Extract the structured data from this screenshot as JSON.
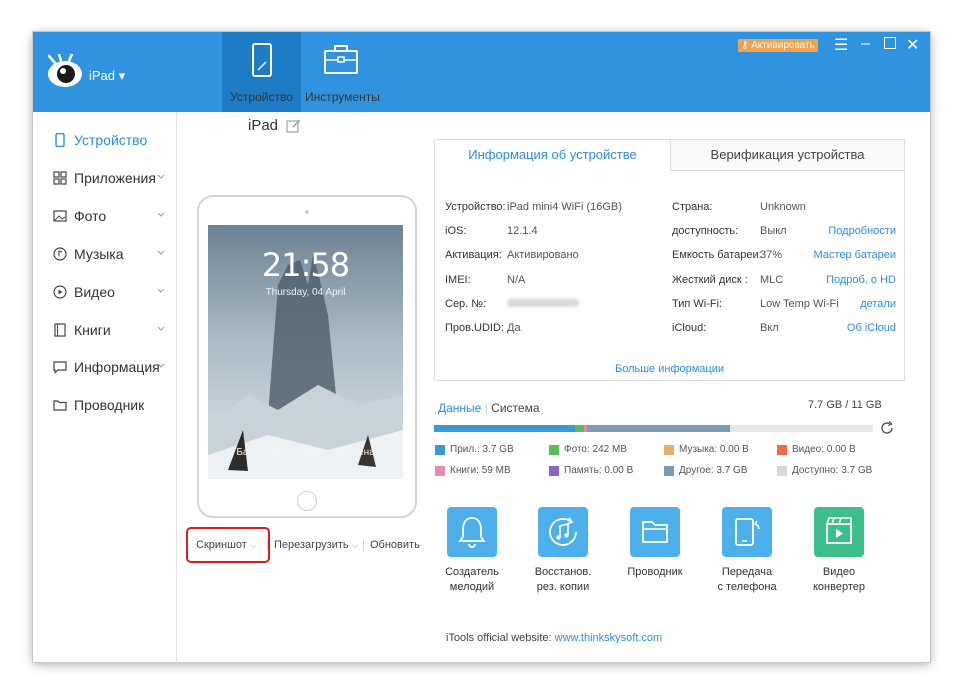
{
  "titlebar": {
    "device_name": "iPad ▾",
    "tabs": [
      "Устройство",
      "Инструменты"
    ],
    "activate_label": "Активировать"
  },
  "sidebar": {
    "items": [
      "Устройство",
      "Приложения",
      "Фото",
      "Музыка",
      "Видео",
      "Книги",
      "Информация",
      "Проводник"
    ]
  },
  "device": {
    "title": "iPad",
    "clock": "21:58",
    "date": "Thursday, 04 April",
    "battery_text": "Батарея полностью заряжена"
  },
  "actions": {
    "screenshot": "Скриншот",
    "reboot": "Перезагрузить",
    "refresh": "Обновить"
  },
  "info": {
    "tabs": [
      "Информация об устройстве",
      "Верификация устройства"
    ],
    "left": [
      {
        "label": "Устройство:",
        "value": "iPad mini4 WiFi   (16GB)"
      },
      {
        "label": "iOS:",
        "value": "12.1.4"
      },
      {
        "label": "Активация:",
        "value": "Активировано"
      },
      {
        "label": "IMEI:",
        "value": "N/A"
      },
      {
        "label": "Сер. №:",
        "value": ""
      },
      {
        "label": "Пров.UDID:",
        "value": "Да"
      }
    ],
    "right": [
      {
        "label": "Страна:",
        "value": "Unknown",
        "link": ""
      },
      {
        "label": "доступность:",
        "value": "Выкл",
        "link": "Подробности"
      },
      {
        "label": "Емкость батареи:",
        "value": "37%",
        "link": "Мастер батареи"
      },
      {
        "label": "Жесткий диск :",
        "value": "MLC",
        "link": "Подроб. о HD"
      },
      {
        "label": "Тип Wi-Fi:",
        "value": "Low Temp Wi-Fi",
        "link": "детали"
      },
      {
        "label": "iCloud:",
        "value": "Вкл",
        "link": "Об iCloud"
      }
    ],
    "more": "Больше информации"
  },
  "storage": {
    "tab_data": "Данные",
    "tab_system": "Система",
    "total": "7.7 GB / 11 GB",
    "used_fraction": 0.7,
    "segments": [
      {
        "name": "Прил.",
        "value": "3.7 GB",
        "color": "#3b9ad8"
      },
      {
        "name": "Фото",
        "value": "242 MB",
        "color": "#5bbd59"
      },
      {
        "name": "Музыка",
        "value": "0.00 B",
        "color": "#e3b36b"
      },
      {
        "name": "Видео",
        "value": "0.00 B",
        "color": "#ef6b45"
      },
      {
        "name": "Книги",
        "value": "59 MB",
        "color": "#e88ab8"
      },
      {
        "name": "Память",
        "value": "0.00 B",
        "color": "#8c63c8"
      },
      {
        "name": "Другое",
        "value": "3.7 GB",
        "color": "#7e99b0"
      },
      {
        "name": "Доступно",
        "value": "3.7 GB",
        "color": "#d8d8d8"
      }
    ]
  },
  "tools": [
    {
      "line1": "Создатель",
      "line2": "мелодий",
      "icon": "bell-icon",
      "color": "#4eb0ea"
    },
    {
      "line1": "Восстанов.",
      "line2": "рез. копии",
      "icon": "music-restore-icon",
      "color": "#4eb0ea"
    },
    {
      "line1": "Проводник",
      "line2": "",
      "icon": "folder-icon",
      "color": "#4eb0ea"
    },
    {
      "line1": "Передача",
      "line2": "с телефона",
      "icon": "phone-transfer-icon",
      "color": "#4eb0ea"
    },
    {
      "line1": "Видео",
      "line2": "конвертер",
      "icon": "video-converter-icon",
      "color": "#3dbf8c"
    }
  ],
  "footer": {
    "text": "iTools official website: ",
    "link": "www.thinkskysoft.com"
  }
}
